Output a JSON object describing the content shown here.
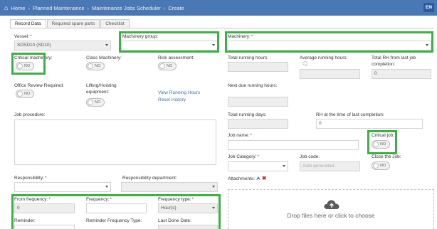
{
  "breadcrumb": {
    "home": "Home",
    "items": [
      "Planned Maintenance",
      "Maintenance Jobs Scheduler",
      "Create"
    ]
  },
  "lang": "EN",
  "tabs": [
    "Record Data",
    "Required spare parts",
    "Checklist"
  ],
  "vessel": {
    "label": "Vessel:",
    "value": "SDSD10 (SD10)"
  },
  "machinery_group": {
    "label": "Machinery group:",
    "value": ""
  },
  "machinery": {
    "label": "Machinery:",
    "value": ""
  },
  "critical_machinery": {
    "label": "Critical machinery:",
    "toggle": "NO"
  },
  "class_machinery": {
    "label": "Class Machinery:",
    "toggle": "NO"
  },
  "risk_assessment": {
    "label": "Risk assessment:",
    "toggle": "NO"
  },
  "total_running_hours": {
    "label": "Total running hours:",
    "value": ""
  },
  "avg_running_hours": {
    "label": "Average running hours:",
    "value": ""
  },
  "total_rh_last_job": {
    "label": "Total RH from last job completion:",
    "value": "0"
  },
  "office_review": {
    "label": "Office Review Required:",
    "toggle": "NO"
  },
  "lifting_hoisting": {
    "label": "Lifting/Hoisting equipment:",
    "toggle": "NO"
  },
  "links": {
    "view_running_hours": "View Running Hours",
    "reset_history": "Reset History"
  },
  "next_due_running_hours": {
    "label": "Next due running hours:",
    "value": ""
  },
  "job_procedure": {
    "label": "Job procedure:"
  },
  "total_running_days": {
    "label": "Total running days:",
    "value": ""
  },
  "rh_last_completion": {
    "label": "RH at the time of last completion:",
    "value": "0"
  },
  "job_name": {
    "label": "Job name:",
    "value": ""
  },
  "critical_job": {
    "label": "Critical job:",
    "toggle": "NO"
  },
  "job_category": {
    "label": "Job Category:",
    "value": ""
  },
  "job_code": {
    "label": "Job code:",
    "placeholder": "Auto generated"
  },
  "close_job": {
    "label": "Close the Job:",
    "toggle": "NO"
  },
  "responsibility": {
    "label": "Responsibility:",
    "value": ""
  },
  "responsibility_department": {
    "label": "Responsibility department:",
    "value": ""
  },
  "attachments": {
    "label": "Attachments:",
    "dropzone": "Drop files here or click to choose"
  },
  "from_frequency": {
    "label": "From frequency:",
    "value": "0"
  },
  "frequency": {
    "label": "Frequency:",
    "value": ""
  },
  "frequency_type": {
    "label": "Frequency type:",
    "value": "Hour(s)"
  },
  "reminder": {
    "label": "Reminder:"
  },
  "reminder_frequency_type": {
    "label": "Reminder Frequency Type:"
  },
  "last_done_date": {
    "label": "Last Done Date:"
  },
  "colors": {
    "topbar": "#4a78b5",
    "highlight": "#3bb143",
    "required": "#d9162a",
    "link": "#3a6fb0"
  },
  "icons": [
    "home-icon",
    "upload-icon",
    "delete-icon",
    "cloud-upload-icon",
    "comment-icon",
    "chevron-down-icon"
  ]
}
